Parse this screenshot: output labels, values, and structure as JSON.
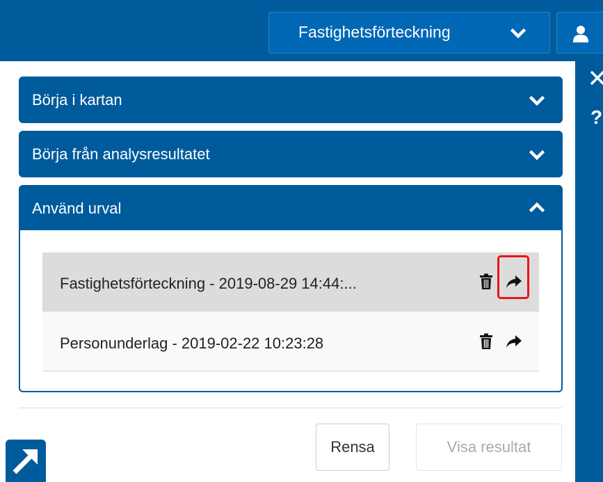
{
  "header": {
    "dropdown_label": "Fastighetsförteckning",
    "dropdown_icon": "chevron-down-icon",
    "user_icon": "user-icon"
  },
  "right_toolbar": {
    "close_icon": "close-icon",
    "help_glyph": "?"
  },
  "panels": [
    {
      "title": "Börja i kartan",
      "expanded": false
    },
    {
      "title": "Börja från analysresultatet",
      "expanded": false
    },
    {
      "title": "Använd urval",
      "expanded": true,
      "items": [
        {
          "label": "Fastighetsförteckning - 2019-08-29 14:44:...",
          "selected": true,
          "highlighted_action": "use-selection-arrow"
        },
        {
          "label": "Personunderlag - 2019-02-22 10:23:28",
          "selected": false
        }
      ]
    }
  ],
  "actions": {
    "clear_label": "Rensa",
    "show_result_label": "Visa resultat",
    "show_result_enabled": false
  },
  "colors": {
    "primary": "#005b9c",
    "selected_row": "#dcdcdc",
    "highlight": "#e8141c"
  }
}
